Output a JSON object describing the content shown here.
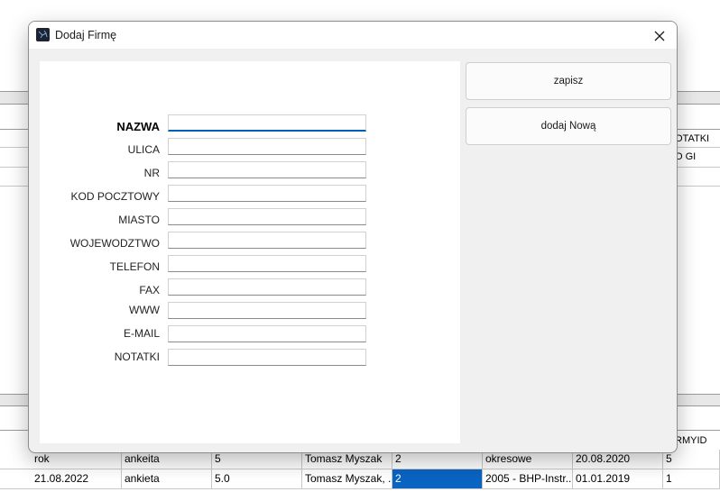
{
  "background": {
    "right_headers": [
      "OTATKI",
      "O GI"
    ],
    "bottom_header_right": "RMYID",
    "rows": [
      {
        "cells": [
          "rok",
          "ankeita",
          "5",
          "Tomasz Myszak",
          "2",
          "okresowe",
          "20.08.2020",
          "5"
        ]
      },
      {
        "cells": [
          "21.08.2022",
          "ankieta",
          "5.0",
          "Tomasz Myszak, ...",
          "2",
          "2005 - BHP-Instr...",
          "01.01.2019",
          "1"
        ]
      }
    ]
  },
  "dialog": {
    "title": "Dodaj Firmę",
    "fields": [
      {
        "label": "NAZWA",
        "value": ""
      },
      {
        "label": "ULICA",
        "value": ""
      },
      {
        "label": "NR",
        "value": ""
      },
      {
        "label": "KOD POCZTOWY",
        "value": ""
      },
      {
        "label": "MIASTO",
        "value": ""
      },
      {
        "label": "WOJEWODZTWO",
        "value": ""
      },
      {
        "label": "TELEFON",
        "value": ""
      },
      {
        "label": "FAX",
        "value": ""
      },
      {
        "label": "WWW",
        "value": ""
      },
      {
        "label": "E-MAIL",
        "value": ""
      },
      {
        "label": "NOTATKI",
        "value": ""
      }
    ],
    "buttons": {
      "save": "zapisz",
      "add_new": "dodaj Nową"
    }
  },
  "colors": {
    "accent": "#005fb8",
    "selection": "#0a64c2"
  }
}
